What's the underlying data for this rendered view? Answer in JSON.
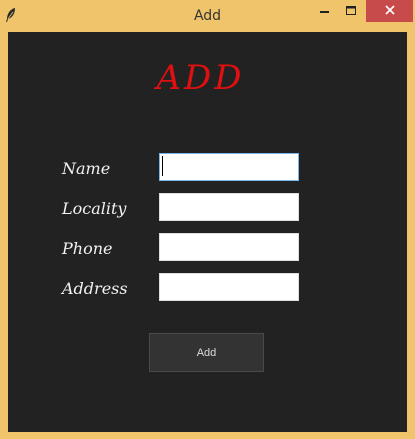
{
  "window": {
    "title": "Add",
    "icon": "feather-icon",
    "controls": [
      "minimize-icon",
      "maximize-icon",
      "close-icon"
    ],
    "title_bar_color": "#f0c46a",
    "close_button_color": "#c74b4b"
  },
  "form": {
    "heading": "ADD",
    "heading_color": "#e01010",
    "background_color": "#222222",
    "fields": [
      {
        "label": "Name",
        "value": "",
        "focused": true
      },
      {
        "label": "Locality",
        "value": ""
      },
      {
        "label": "Phone",
        "value": ""
      },
      {
        "label": "Address",
        "value": ""
      }
    ],
    "submit_label": "Add"
  }
}
